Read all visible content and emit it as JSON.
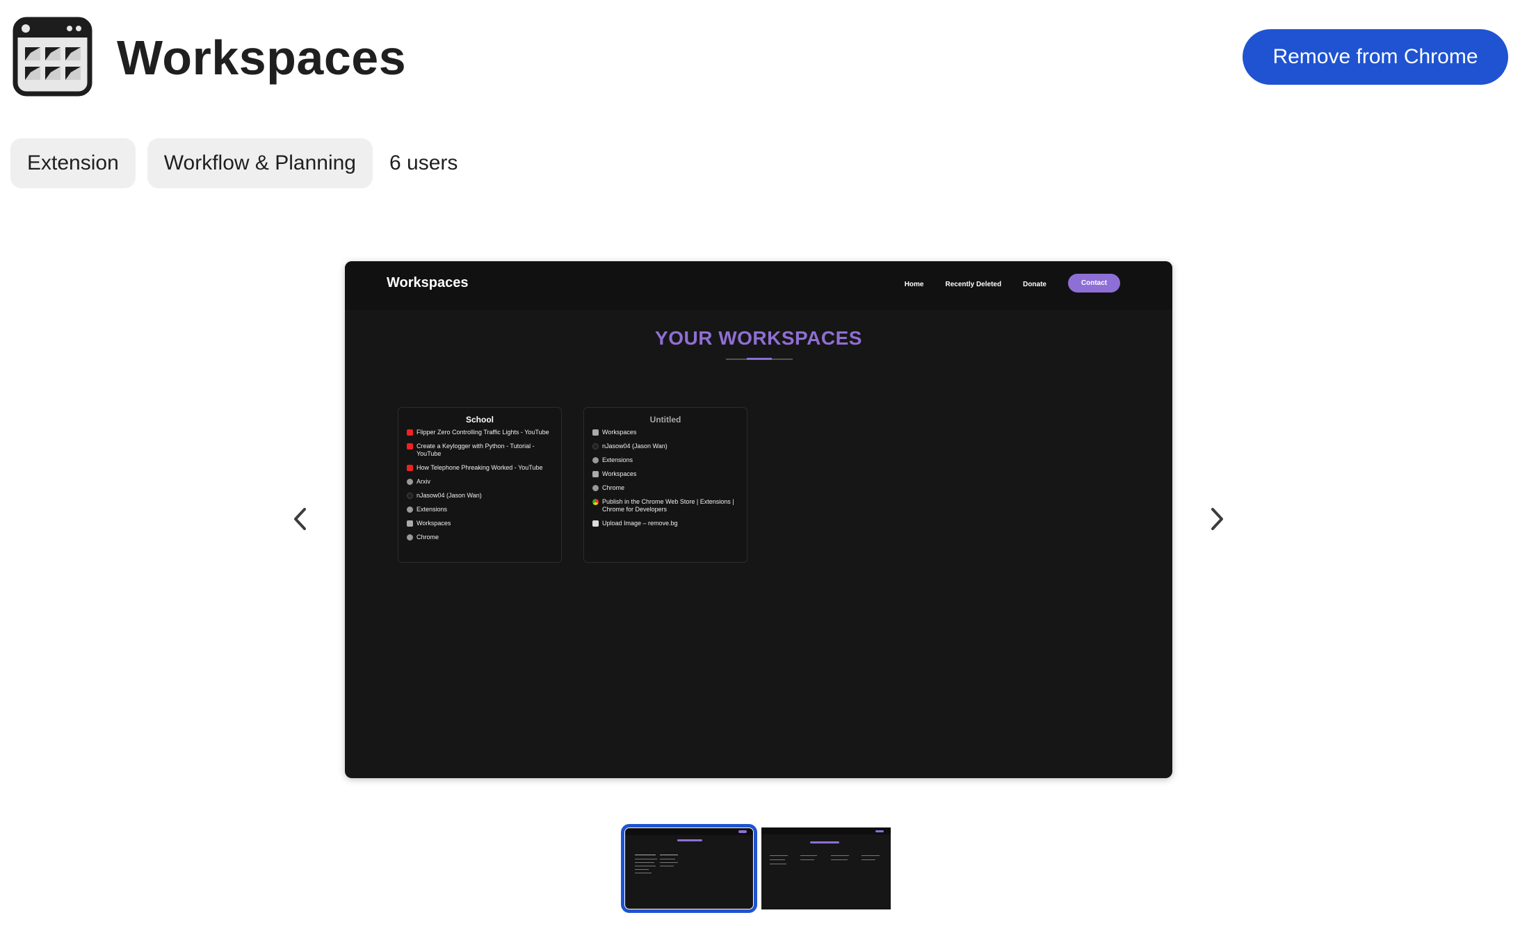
{
  "header": {
    "title": "Workspaces",
    "remove_button": "Remove from Chrome",
    "app_icon": "browser-grid-icon"
  },
  "chips": {
    "type": "Extension",
    "category": "Workflow & Planning",
    "users": "6 users"
  },
  "carousel": {
    "prev_icon": "chevron-left-icon",
    "next_icon": "chevron-right-icon",
    "active_index": 0,
    "thumbnail_count": 2
  },
  "slide": {
    "brand": "Workspaces",
    "nav": {
      "home": "Home",
      "recently_deleted": "Recently Deleted",
      "donate": "Donate",
      "contact": "Contact"
    },
    "heading": "YOUR WORKSPACES",
    "cards": [
      {
        "title": "School",
        "items": [
          {
            "icon": "youtube-icon",
            "text": "Flipper Zero Controlling Traffic Lights - YouTube"
          },
          {
            "icon": "youtube-icon",
            "text": "Create a Keylogger with Python - Tutorial - YouTube"
          },
          {
            "icon": "youtube-icon",
            "text": "How Telephone Phreaking Worked - YouTube"
          },
          {
            "icon": "globe-icon",
            "text": "Arxiv"
          },
          {
            "icon": "github-icon",
            "text": "nJasow04 (Jason Wan)"
          },
          {
            "icon": "globe-icon",
            "text": "Extensions"
          },
          {
            "icon": "workspaces-icon",
            "text": "Workspaces"
          },
          {
            "icon": "globe-icon",
            "text": "Chrome"
          }
        ]
      },
      {
        "title": "Untitled",
        "items": [
          {
            "icon": "workspaces-icon",
            "text": "Workspaces"
          },
          {
            "icon": "github-icon",
            "text": "nJasow04 (Jason Wan)"
          },
          {
            "icon": "globe-icon",
            "text": "Extensions"
          },
          {
            "icon": "workspaces-icon",
            "text": "Workspaces"
          },
          {
            "icon": "globe-icon",
            "text": "Chrome"
          },
          {
            "icon": "chrome-web-store-icon",
            "text": "Publish in the Chrome Web Store | Extensions | Chrome for Developers"
          },
          {
            "icon": "remove-bg-icon",
            "text": "Upload Image – remove.bg"
          }
        ]
      }
    ]
  },
  "colors": {
    "primary_button": "#1f53d1",
    "accent_purple": "#8e6fd6",
    "slide_bg": "#161616",
    "chip_bg": "#efefef"
  }
}
